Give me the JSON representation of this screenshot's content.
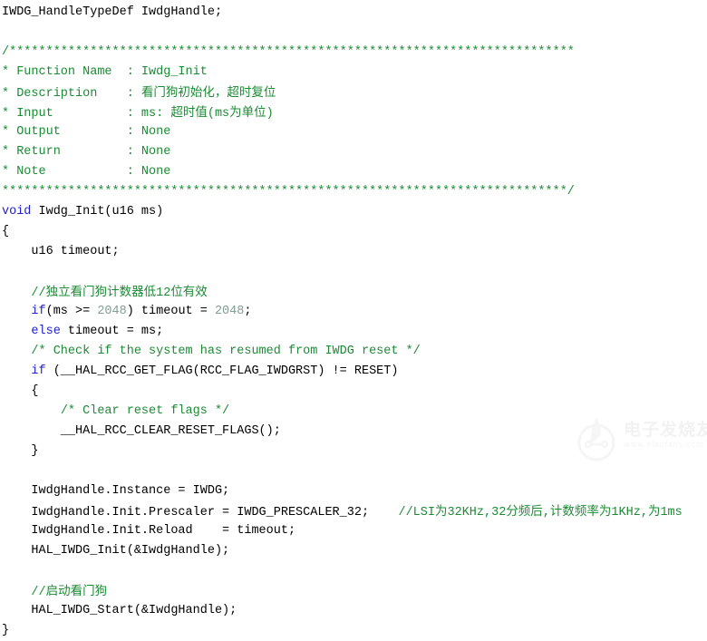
{
  "editor": {
    "background_color": "#ffffff",
    "default_text_color": "#000000",
    "comment_color": "#1d8a35",
    "keyword_color": "#2020d0",
    "number_color": "#7f9f8f",
    "language": "C",
    "line_count": 23
  },
  "watermark": {
    "brand": "电子发烧友",
    "url": "www.elecfans.com",
    "logo_icon": "circuit-chip-icon"
  },
  "code_lines": [
    {
      "index": 0,
      "tokens": [
        {
          "type": "plain",
          "text": "IWDG_HandleTypeDef IwdgHandle;"
        }
      ]
    },
    {
      "index": 1,
      "tokens": [
        {
          "type": "plain",
          "text": ""
        }
      ]
    },
    {
      "index": 2,
      "tokens": [
        {
          "type": "comment",
          "text": "/*****************************************************************************"
        }
      ]
    },
    {
      "index": 3,
      "tokens": [
        {
          "type": "comment",
          "text": "* Function Name  : Iwdg_Init"
        }
      ]
    },
    {
      "index": 4,
      "tokens": [
        {
          "type": "comment",
          "text": "* Description    : "
        },
        {
          "type": "comment-cjk",
          "text": "看门狗初始化，超时复位"
        }
      ]
    },
    {
      "index": 5,
      "tokens": [
        {
          "type": "comment",
          "text": "* Input          : ms: "
        },
        {
          "type": "comment-cjk",
          "text": "超时值"
        },
        {
          "type": "comment",
          "text": "(ms"
        },
        {
          "type": "comment-cjk",
          "text": "为单位"
        },
        {
          "type": "comment",
          "text": ")"
        }
      ]
    },
    {
      "index": 6,
      "tokens": [
        {
          "type": "comment",
          "text": "* Output         : None"
        }
      ]
    },
    {
      "index": 7,
      "tokens": [
        {
          "type": "comment",
          "text": "* Return         : None"
        }
      ]
    },
    {
      "index": 8,
      "tokens": [
        {
          "type": "comment",
          "text": "* Note           : None"
        }
      ]
    },
    {
      "index": 9,
      "tokens": [
        {
          "type": "comment",
          "text": "*****************************************************************************/"
        }
      ]
    },
    {
      "index": 10,
      "tokens": [
        {
          "type": "keyword",
          "text": "void"
        },
        {
          "type": "plain",
          "text": " Iwdg_Init(u16 ms)"
        }
      ]
    },
    {
      "index": 11,
      "tokens": [
        {
          "type": "plain",
          "text": "{"
        }
      ]
    },
    {
      "index": 12,
      "tokens": [
        {
          "type": "plain",
          "text": "    u16 timeout;"
        }
      ]
    },
    {
      "index": 13,
      "tokens": [
        {
          "type": "plain",
          "text": ""
        }
      ]
    },
    {
      "index": 14,
      "tokens": [
        {
          "type": "comment",
          "text": "    //"
        },
        {
          "type": "comment-cjk",
          "text": "独立看门狗计数器低"
        },
        {
          "type": "comment",
          "text": "12"
        },
        {
          "type": "comment-cjk",
          "text": "位有效"
        }
      ]
    },
    {
      "index": 15,
      "tokens": [
        {
          "type": "plain",
          "text": "    "
        },
        {
          "type": "keyword",
          "text": "if"
        },
        {
          "type": "plain",
          "text": "(ms >= "
        },
        {
          "type": "number",
          "text": "2048"
        },
        {
          "type": "plain",
          "text": ") timeout = "
        },
        {
          "type": "number",
          "text": "2048"
        },
        {
          "type": "plain",
          "text": ";"
        }
      ]
    },
    {
      "index": 16,
      "tokens": [
        {
          "type": "plain",
          "text": "    "
        },
        {
          "type": "keyword",
          "text": "else"
        },
        {
          "type": "plain",
          "text": " timeout = ms;"
        }
      ]
    },
    {
      "index": 17,
      "tokens": [
        {
          "type": "plain",
          "text": "    "
        },
        {
          "type": "comment",
          "text": "/* Check if the system has resumed from IWDG reset */"
        }
      ]
    },
    {
      "index": 18,
      "tokens": [
        {
          "type": "plain",
          "text": "    "
        },
        {
          "type": "keyword",
          "text": "if"
        },
        {
          "type": "plain",
          "text": " (__HAL_RCC_GET_FLAG(RCC_FLAG_IWDGRST) != RESET)"
        }
      ]
    },
    {
      "index": 19,
      "tokens": [
        {
          "type": "plain",
          "text": "    {"
        }
      ]
    },
    {
      "index": 20,
      "tokens": [
        {
          "type": "plain",
          "text": "        "
        },
        {
          "type": "comment",
          "text": "/* Clear reset flags */"
        }
      ]
    },
    {
      "index": 21,
      "tokens": [
        {
          "type": "plain",
          "text": "        __HAL_RCC_CLEAR_RESET_FLAGS();"
        }
      ]
    },
    {
      "index": 22,
      "tokens": [
        {
          "type": "plain",
          "text": "    }"
        }
      ]
    },
    {
      "index": 23,
      "tokens": [
        {
          "type": "plain",
          "text": ""
        }
      ]
    },
    {
      "index": 24,
      "tokens": [
        {
          "type": "plain",
          "text": "    IwdgHandle.Instance = IWDG;"
        }
      ]
    },
    {
      "index": 25,
      "tokens": [
        {
          "type": "plain",
          "text": "    IwdgHandle.Init.Prescaler = IWDG_PRESCALER_32;    "
        },
        {
          "type": "comment",
          "text": "//LSI"
        },
        {
          "type": "comment-cjk",
          "text": "为"
        },
        {
          "type": "comment",
          "text": "32KHz,32"
        },
        {
          "type": "comment-cjk",
          "text": "分频后"
        },
        {
          "type": "comment",
          "text": ","
        },
        {
          "type": "comment-cjk",
          "text": "计数频率为"
        },
        {
          "type": "comment",
          "text": "1KHz,"
        },
        {
          "type": "comment-cjk",
          "text": "为"
        },
        {
          "type": "comment",
          "text": "1ms"
        }
      ]
    },
    {
      "index": 26,
      "tokens": [
        {
          "type": "plain",
          "text": "    IwdgHandle.Init.Reload    = timeout;"
        }
      ]
    },
    {
      "index": 27,
      "tokens": [
        {
          "type": "plain",
          "text": "    HAL_IWDG_Init(&IwdgHandle);"
        }
      ]
    },
    {
      "index": 28,
      "tokens": [
        {
          "type": "plain",
          "text": ""
        }
      ]
    },
    {
      "index": 29,
      "tokens": [
        {
          "type": "comment",
          "text": "    //"
        },
        {
          "type": "comment-cjk",
          "text": "启动看门狗"
        }
      ]
    },
    {
      "index": 30,
      "tokens": [
        {
          "type": "plain",
          "text": "    HAL_IWDG_Start(&IwdgHandle);"
        }
      ]
    },
    {
      "index": 31,
      "tokens": [
        {
          "type": "plain",
          "text": "}"
        }
      ]
    }
  ]
}
